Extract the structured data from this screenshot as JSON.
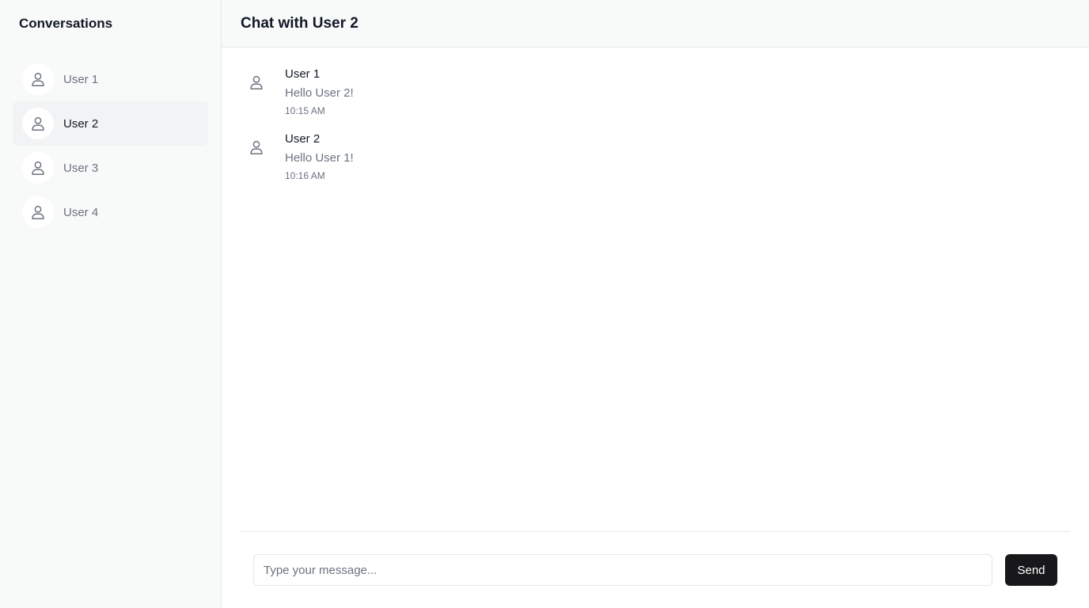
{
  "sidebar": {
    "title": "Conversations",
    "items": [
      {
        "label": "User 1",
        "icon": "user-icon",
        "active": false
      },
      {
        "label": "User 2",
        "icon": "user-icon",
        "active": true
      },
      {
        "label": "User 3",
        "icon": "user-icon",
        "active": false
      },
      {
        "label": "User 4",
        "icon": "user-icon",
        "active": false
      }
    ]
  },
  "header": {
    "title": "Chat with User 2"
  },
  "messages": [
    {
      "sender": "User 1",
      "text": "Hello User 2!",
      "time": "10:15 AM",
      "icon": "user-icon"
    },
    {
      "sender": "User 2",
      "text": "Hello User 1!",
      "time": "10:16 AM",
      "icon": "user-icon"
    }
  ],
  "composer": {
    "placeholder": "Type your message...",
    "value": "",
    "send_label": "Send"
  },
  "colors": {
    "sidebar_bg": "#f8faf9",
    "active_item_bg": "#f2f3f5",
    "muted_text": "#6b7280",
    "primary_text": "#111827",
    "send_button_bg": "#18181b",
    "border": "#e5e7eb"
  }
}
